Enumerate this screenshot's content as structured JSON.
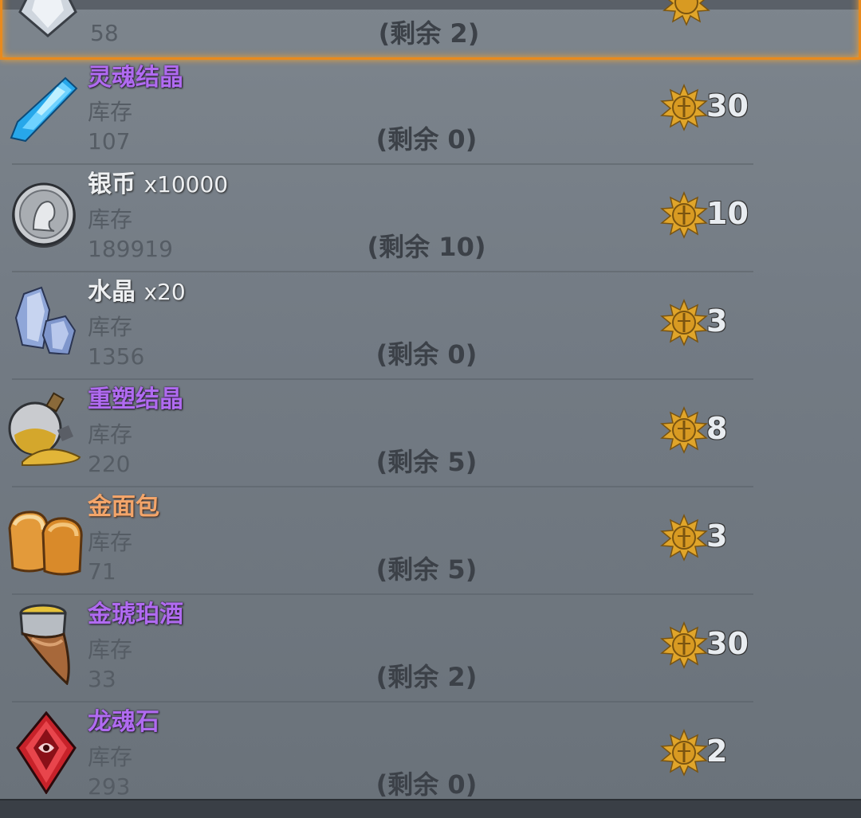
{
  "colors": {
    "accent_selected": "#e88a1e",
    "rare": "#b06bf0",
    "epic": "#f3a56a",
    "currency": "#e0a52a"
  },
  "labels": {
    "stock": "库存"
  },
  "items": [
    {
      "name": "",
      "qty": "",
      "stock": "58",
      "remaining": "(剩余 2)",
      "price": "",
      "icon": "gem-icon",
      "selected": true
    },
    {
      "name": "灵魂结晶",
      "qty": "",
      "stock": "107",
      "remaining": "(剩余 0)",
      "price": "30",
      "icon": "soul-crystal-icon",
      "rarity": "purple"
    },
    {
      "name": "银币",
      "qty": "x10000",
      "stock": "189919",
      "remaining": "(剩余 10)",
      "price": "10",
      "icon": "silver-coin-icon",
      "rarity": "white"
    },
    {
      "name": "水晶",
      "qty": "x20",
      "stock": "1356",
      "remaining": "(剩余 0)",
      "price": "3",
      "icon": "crystal-cluster-icon",
      "rarity": "white"
    },
    {
      "name": "重塑结晶",
      "qty": "",
      "stock": "220",
      "remaining": "(剩余 5)",
      "price": "8",
      "icon": "reforge-crystal-icon",
      "rarity": "purple"
    },
    {
      "name": "金面包",
      "qty": "",
      "stock": "71",
      "remaining": "(剩余 5)",
      "price": "3",
      "icon": "golden-bread-icon",
      "rarity": "orange"
    },
    {
      "name": "金琥珀酒",
      "qty": "",
      "stock": "33",
      "remaining": "(剩余 2)",
      "price": "30",
      "icon": "amber-mead-horn-icon",
      "rarity": "purple"
    },
    {
      "name": "龙魂石",
      "qty": "",
      "stock": "293",
      "remaining": "(剩余 0)",
      "price": "2",
      "icon": "dragon-soul-stone-icon",
      "rarity": "purple"
    }
  ]
}
